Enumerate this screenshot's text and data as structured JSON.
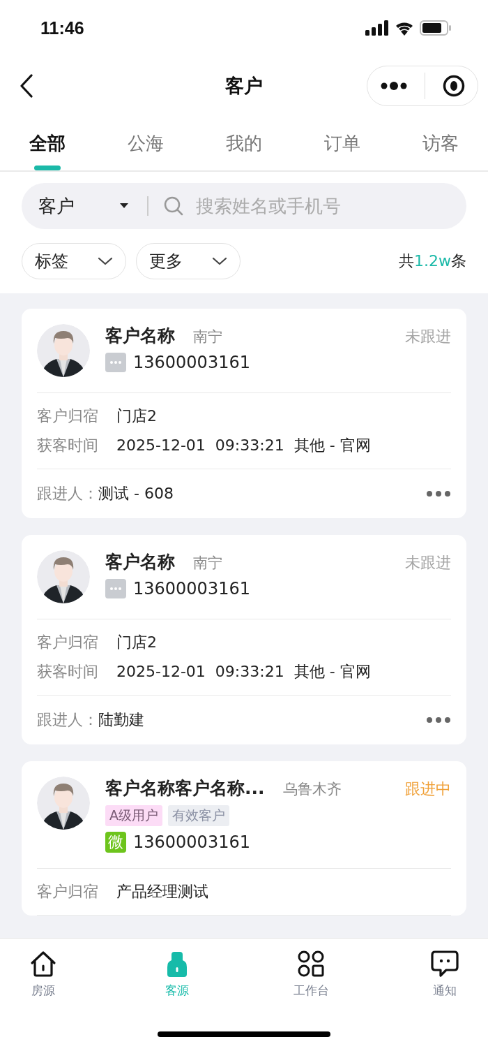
{
  "status_bar": {
    "time": "11:46"
  },
  "nav": {
    "title": "客户"
  },
  "tabs": [
    {
      "label": "全部",
      "selected": true
    },
    {
      "label": "公海",
      "selected": false
    },
    {
      "label": "我的",
      "selected": false
    },
    {
      "label": "订单",
      "selected": false
    },
    {
      "label": "访客",
      "selected": false
    }
  ],
  "search": {
    "scope": "客户",
    "placeholder": "搜索姓名或手机号"
  },
  "filters": [
    {
      "label": "标签"
    },
    {
      "label": "更多"
    }
  ],
  "count": {
    "prefix": "共",
    "value": "1.2w",
    "suffix": "条"
  },
  "customers": [
    {
      "name": "客户名称",
      "city": "南宁",
      "status": {
        "text": "未跟进",
        "kind": "pending"
      },
      "contact": {
        "kind": "chat"
      },
      "phone": "13600003161",
      "fields": [
        {
          "label": "客户归宿",
          "value": "门店2"
        },
        {
          "label": "获客时间",
          "value": "2025-12-01  09:33:21  其他 - 官网"
        }
      ],
      "follower": {
        "label": "跟进人：",
        "value": "测试 - 608"
      }
    },
    {
      "name": "客户名称",
      "city": "南宁",
      "status": {
        "text": "未跟进",
        "kind": "pending"
      },
      "contact": {
        "kind": "chat"
      },
      "phone": "13600003161",
      "fields": [
        {
          "label": "客户归宿",
          "value": "门店2"
        },
        {
          "label": "获客时间",
          "value": "2025-12-01  09:33:21  其他 - 官网"
        }
      ],
      "follower": {
        "label": "跟进人：",
        "value": "陆勤建"
      }
    },
    {
      "name": "客户名称客户名称...",
      "city": "乌鲁木齐",
      "status": {
        "text": "跟进中",
        "kind": "active"
      },
      "tags": [
        {
          "label": "A级用户",
          "kind": "grade"
        },
        {
          "label": "有效客户",
          "kind": "valid"
        }
      ],
      "contact": {
        "kind": "wechat",
        "label": "微"
      },
      "phone": "13600003161",
      "fields": [
        {
          "label": "客户归宿",
          "value": "产品经理测试"
        }
      ]
    }
  ],
  "bottom_nav": [
    {
      "label": "房源",
      "kind": "house",
      "selected": false
    },
    {
      "label": "客源",
      "kind": "person",
      "selected": true
    },
    {
      "label": "工作台",
      "kind": "grid",
      "selected": false
    },
    {
      "label": "通知",
      "kind": "chat",
      "selected": false
    }
  ]
}
